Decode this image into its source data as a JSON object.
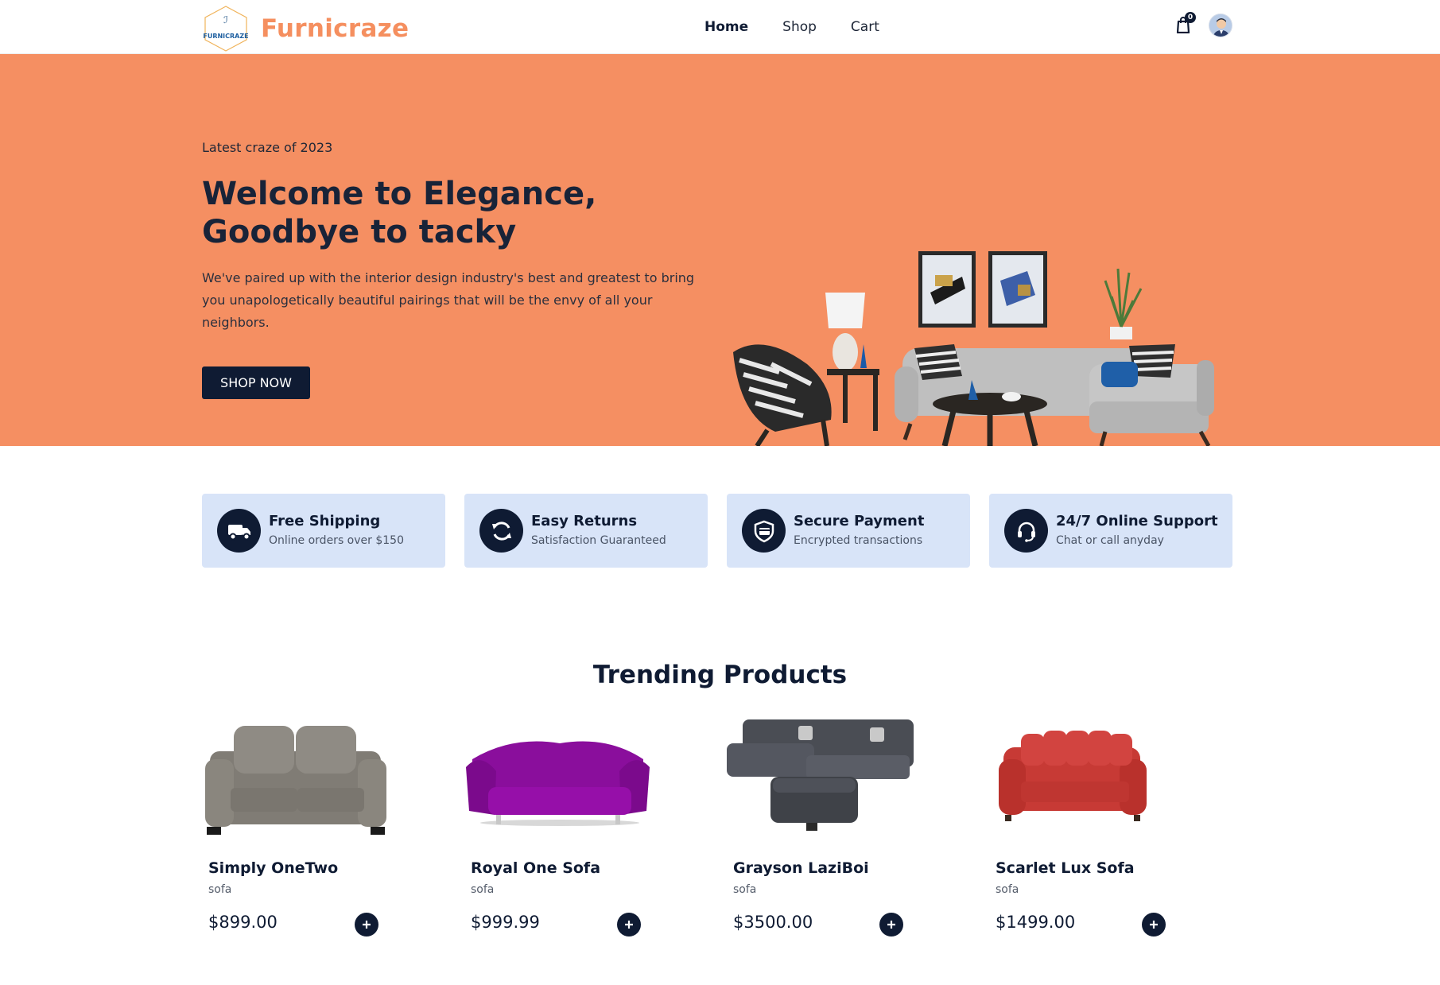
{
  "brand": {
    "logo_text": "FURNICRAZE",
    "name": "Furnicraze",
    "accent_color": "#f58f5f"
  },
  "nav": {
    "links": [
      {
        "label": "Home",
        "active": true
      },
      {
        "label": "Shop",
        "active": false
      },
      {
        "label": "Cart",
        "active": false
      }
    ],
    "cart_count": "0",
    "cart_icon": "shopping-bag-icon",
    "avatar_icon": "user-avatar-icon"
  },
  "hero": {
    "eyebrow": "Latest craze of 2023",
    "title_line1": "Welcome to Elegance,",
    "title_line2": "Goodbye to tacky",
    "description": "We've paired up with the interior design industry's best and greatest to bring you unapologetically beautiful pairings that will be the envy of all your neighbors.",
    "cta_label": "SHOP NOW",
    "background_color": "#f58f62",
    "image": "living-room-sofa-set-image"
  },
  "features": [
    {
      "icon": "truck-icon",
      "title": "Free Shipping",
      "subtitle": "Online orders over $150"
    },
    {
      "icon": "refresh-icon",
      "title": "Easy Returns",
      "subtitle": "Satisfaction Guaranteed"
    },
    {
      "icon": "secure-card-icon",
      "title": "Secure Payment",
      "subtitle": "Encrypted transactions"
    },
    {
      "icon": "headset-icon",
      "title": "24/7 Online Support",
      "subtitle": "Chat or call anyday"
    }
  ],
  "trending": {
    "title": "Trending Products",
    "products": [
      {
        "name": "Simply OneTwo",
        "category": "sofa",
        "price": "$899.00",
        "image": "gray-loveseat-image"
      },
      {
        "name": "Royal One Sofa",
        "category": "sofa",
        "price": "$999.99",
        "image": "purple-sofa-image"
      },
      {
        "name": "Grayson LaziBoi",
        "category": "sofa",
        "price": "$3500.00",
        "image": "sectional-sofa-ottoman-image"
      },
      {
        "name": "Scarlet Lux Sofa",
        "category": "sofa",
        "price": "$1499.00",
        "image": "red-sofa-image"
      }
    ]
  }
}
